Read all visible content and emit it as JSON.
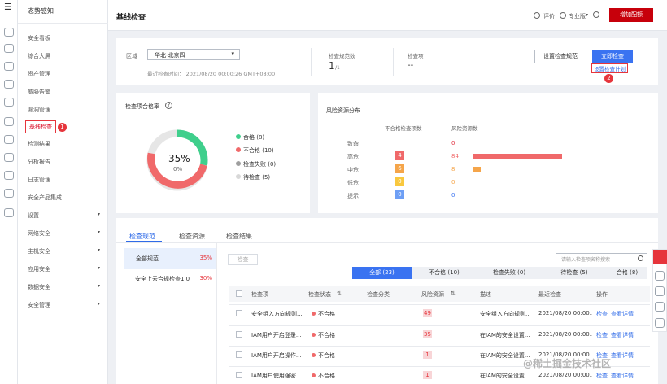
{
  "iconbar": {
    "menu_glyph": "☰",
    "icons": [
      "cloud-icon",
      "cloud-icon",
      "terminal-icon",
      "database-icon",
      "document-icon",
      "file-icon",
      "cloud-icon",
      "anchor-icon",
      "settings-icon",
      "clock-icon",
      "shield-icon"
    ]
  },
  "sidebar": {
    "title": "态势感知",
    "items": [
      {
        "label": "安全看板"
      },
      {
        "label": "综合大屏"
      },
      {
        "label": "资产管理"
      },
      {
        "label": "威胁告警"
      },
      {
        "label": "漏洞管理"
      },
      {
        "label": "基线检查",
        "active": true
      },
      {
        "label": "检测结果"
      },
      {
        "label": "分析报告"
      },
      {
        "label": "日志管理"
      },
      {
        "label": "安全产品集成"
      },
      {
        "label": "设置",
        "arrow": "▾"
      },
      {
        "label": "网络安全",
        "arrow": "▾"
      },
      {
        "label": "主机安全",
        "arrow": "▾"
      },
      {
        "label": "应用安全",
        "arrow": "▾"
      },
      {
        "label": "数据安全",
        "arrow": "▾"
      },
      {
        "label": "安全管理",
        "arrow": "▾"
      }
    ],
    "badge1": "1"
  },
  "header": {
    "title": "基线检查",
    "rate_label": "评价",
    "edition_label": "专业版",
    "edition_arrow": "▾",
    "upgrade_label": "增加配额"
  },
  "overview": {
    "region_label": "区域",
    "region_value": "华北-北京四",
    "last_check": "最近检查时间： 2021/08/20 00:00:26 GMT+08:00",
    "spec_count_label": "检查规范数",
    "spec_count": "1",
    "spec_count_total": "/1",
    "items_label": "检查项",
    "items_value": "--",
    "set_spec_button": "设置检查规范",
    "check_now_button": "立即检查",
    "set_plan_link": "设置检查计划",
    "badge2": "2"
  },
  "pass_rate": {
    "title": "检查项合格率",
    "help": "?",
    "percent_text": "35%",
    "sub_text": "0%",
    "legend": [
      {
        "label": "合格 (8)",
        "color": "#3fcf8c"
      },
      {
        "label": "不合格 (10)",
        "color": "#f0696a"
      },
      {
        "label": "检查失败 (0)",
        "color": "#9e9e9e"
      },
      {
        "label": "待检查 (5)",
        "color": "#d8d8d8"
      }
    ]
  },
  "risk": {
    "title": "风险资源分布",
    "col_items": "不合格检查项数",
    "col_resources": "风险资源数",
    "rows": [
      {
        "level": "致命",
        "items": "",
        "items_color": "#e0303f",
        "resources": "0",
        "res_color": "#e0303f",
        "bar": 0
      },
      {
        "level": "高危",
        "items": "4",
        "items_color": "#f0696a",
        "resources": "84",
        "res_color": "#f0696a",
        "bar": 84
      },
      {
        "level": "中危",
        "items": "6",
        "items_color": "#f5a54a",
        "resources": "8",
        "res_color": "#f5a54a",
        "bar": 8
      },
      {
        "level": "低危",
        "items": "0",
        "items_color": "#f9c83e",
        "resources": "0",
        "res_color": "#f5a54a",
        "bar": 0
      },
      {
        "level": "提示",
        "items": "0",
        "items_color": "#6e9ff5",
        "resources": "0",
        "res_color": "#3a73f1",
        "bar": 0
      }
    ]
  },
  "tabs": [
    {
      "label": "检查规范",
      "active": true
    },
    {
      "label": "检查资源"
    },
    {
      "label": "检查结果"
    }
  ],
  "specs": [
    {
      "name": "全部规范",
      "pct": "35%",
      "active": true
    },
    {
      "name": "安全上云合规检查1.0",
      "pct": "30%"
    }
  ],
  "toolbar": {
    "check_button": "检查",
    "search_placeholder": "请输入检查项名称搜索",
    "search_icon": "🔍"
  },
  "filters": [
    {
      "label": "全部 (23)",
      "on": true
    },
    {
      "label": "不合格 (10)"
    },
    {
      "label": "检查失败 (0)"
    },
    {
      "label": "待检查 (5)"
    },
    {
      "label": "合格 (8)"
    }
  ],
  "table": {
    "headers": {
      "item": "检查项",
      "status": "检查状态",
      "category": "检查分类",
      "risk": "风险资源",
      "desc": "描述",
      "recent": "最近检查",
      "ops": "操作"
    },
    "sort_glyph": "⇅",
    "filter_glyph": "▽",
    "rows": [
      {
        "item": "安全组入方向规则...",
        "status": "不合格",
        "risk": "49",
        "desc": "安全组入方向规则...",
        "recent": "2021/08/20 00:00...",
        "op1": "检查",
        "op2": "查看详情"
      },
      {
        "item": "IAM用户开启登录...",
        "status": "不合格",
        "risk": "35",
        "desc": "在IAM的安全设置...",
        "recent": "2021/08/20 00:00...",
        "op1": "检查",
        "op2": "查看详情"
      },
      {
        "item": "IAM用户开启操作...",
        "status": "不合格",
        "risk": "1",
        "desc": "在IAM的安全设置...",
        "recent": "2021/08/20 00:00...",
        "op1": "检查",
        "op2": "查看详情"
      },
      {
        "item": "IAM用户使用强密...",
        "status": "不合格",
        "risk": "1",
        "desc": "在IAM的安全设置...",
        "recent": "2021/08/20 00:00...",
        "op1": "检查",
        "op2": "查看详情"
      }
    ]
  },
  "watermark": "@稀土掘金技术社区"
}
